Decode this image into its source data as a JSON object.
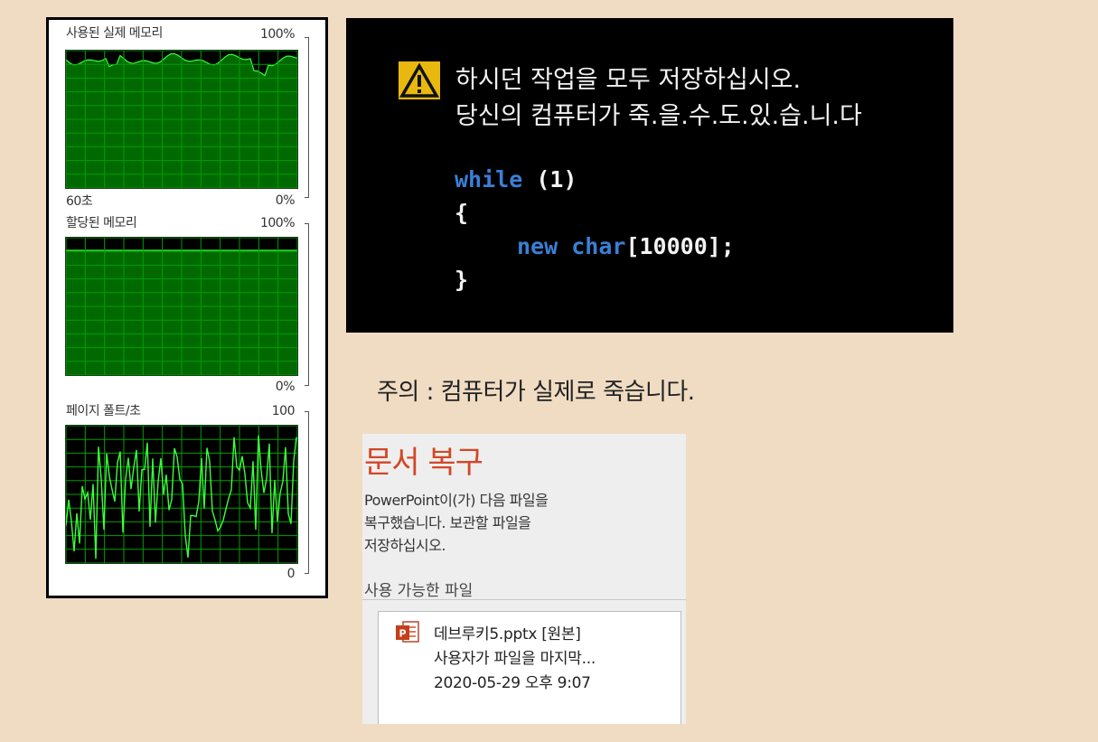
{
  "monitor": {
    "physical_memory": {
      "title": "사용된 실제 메모리",
      "max_label": "100%",
      "time_label": "60초",
      "min_label": "0%"
    },
    "committed_memory": {
      "title": "할당된 메모리",
      "max_label": "100%",
      "min_label": "0%"
    },
    "page_faults": {
      "title": "페이지 폴트/초",
      "max_label": "100",
      "min_label": "0"
    },
    "graph_colors": {
      "grid": "#00a000",
      "fill": "#00c000",
      "line": "#3cff3c",
      "background": "#000000"
    }
  },
  "warning": {
    "icon": "warning-triangle-icon",
    "line1": "하시던 작업을 모두 저장하십시오.",
    "line2": "당신의 컴퓨터가 죽.을.수.도.있.습.니.다",
    "code": {
      "while_kw": "while",
      "condition": " (1)",
      "open_brace": "{",
      "new_kw": "new",
      "char_kw": "char",
      "array_suffix": "[10000];",
      "close_brace": "}"
    }
  },
  "caption": "주의 : 컴퓨터가 실제로 죽습니다.",
  "recovery": {
    "title": "문서 복구",
    "description": [
      "PowerPoint이(가) 다음 파일을",
      "복구했습니다. 보관할 파일을",
      "저장하십시오."
    ],
    "section_label": "사용 가능한 파일",
    "file": {
      "icon": "powerpoint-file-icon",
      "name": "데브루키5.pptx  [원본]",
      "note": "사용자가 파일을 마지막...",
      "timestamp": "2020-05-29 오후 9:07"
    }
  },
  "colors": {
    "page_background": "#efdcc3",
    "accent_red": "#d24726",
    "code_keyword": "#3a7fd6"
  }
}
